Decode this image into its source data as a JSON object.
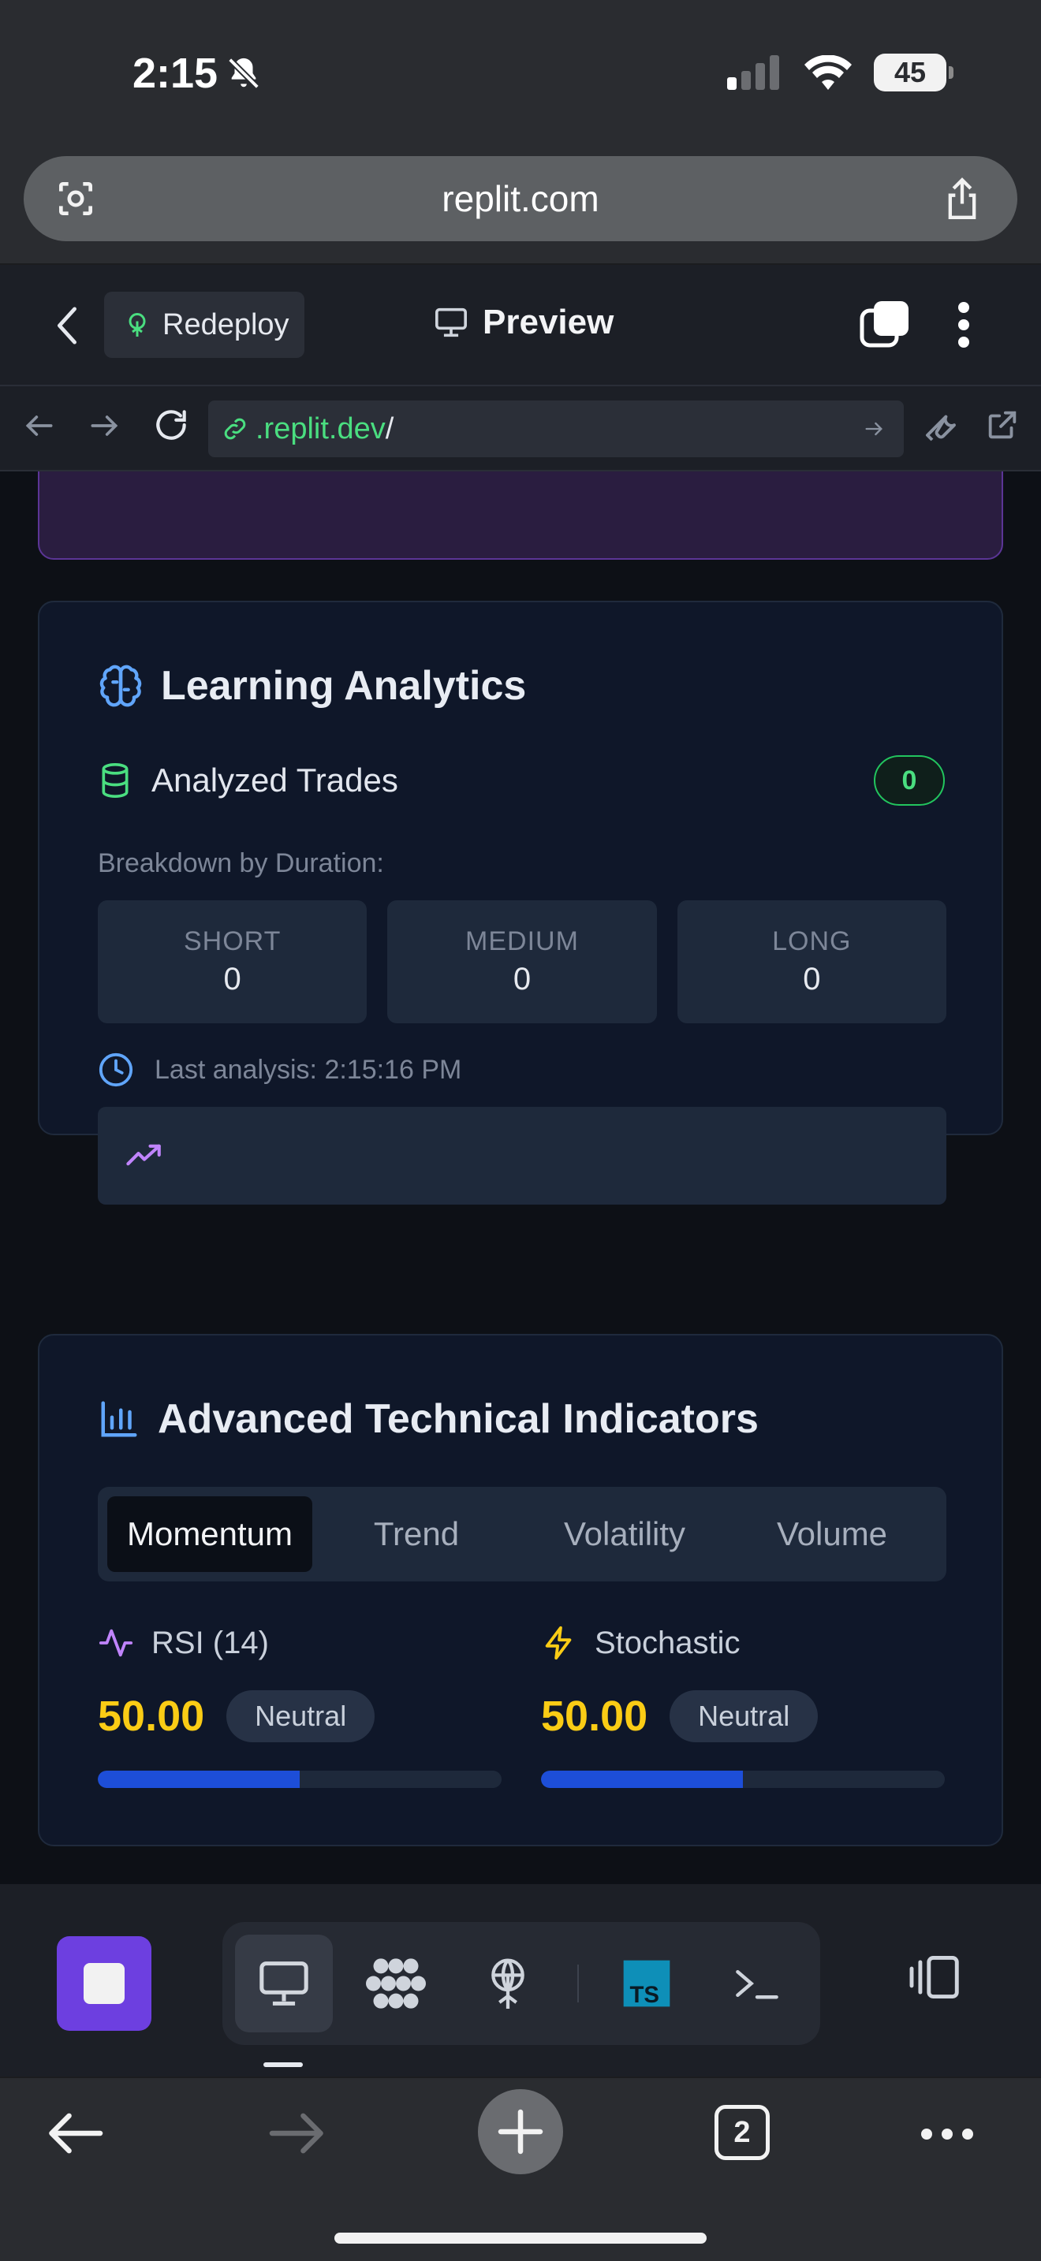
{
  "status_bar": {
    "time": "2:15",
    "battery": "45"
  },
  "browser": {
    "url_display": "replit.com",
    "open_tabs": "2"
  },
  "replit_header": {
    "redeploy_label": "Redeploy",
    "preview_label": "Preview"
  },
  "dev_url": {
    "domain": ".replit.dev",
    "path": "/"
  },
  "learning_analytics": {
    "title": "Learning Analytics",
    "analyzed_label": "Analyzed Trades",
    "analyzed_count": "0",
    "breakdown_label": "Breakdown by Duration:",
    "durations": [
      {
        "label": "SHORT",
        "value": "0"
      },
      {
        "label": "MEDIUM",
        "value": "0"
      },
      {
        "label": "LONG",
        "value": "0"
      }
    ],
    "last_analysis": "Last analysis: 2:15:16 PM"
  },
  "technical_indicators": {
    "title": "Advanced Technical Indicators",
    "tabs": [
      "Momentum",
      "Trend",
      "Volatility",
      "Volume"
    ],
    "active_tab": "Momentum",
    "indicators": [
      {
        "name": "RSI (14)",
        "value": "50.00",
        "status": "Neutral",
        "level_percent": 50,
        "icon": "activity-icon"
      },
      {
        "name": "Stochastic",
        "value": "50.00",
        "status": "Neutral",
        "level_percent": 50,
        "icon": "zap-icon"
      }
    ]
  },
  "colors": {
    "accent_yellow": "#facc15",
    "accent_green": "#22c55e",
    "progress_blue": "#1d4ed8",
    "stop_purple": "#6d3fe0"
  }
}
